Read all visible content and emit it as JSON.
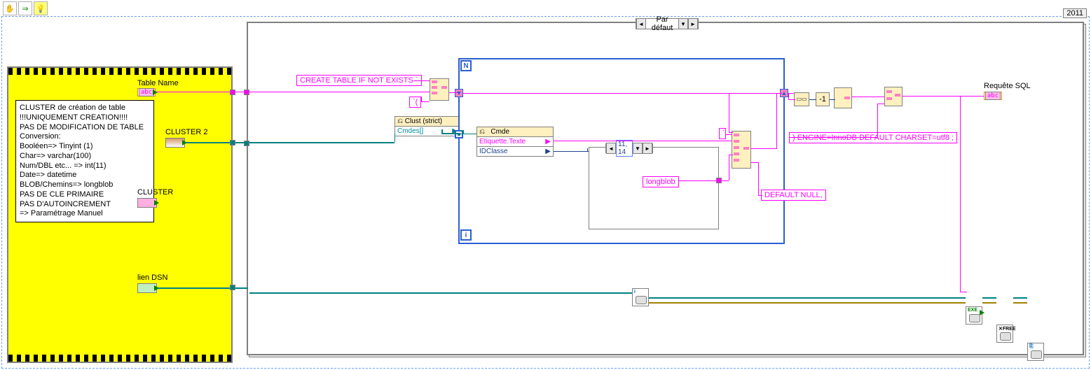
{
  "toolbar": {
    "hand": "✋",
    "arrow": "⇒",
    "bulb": "💡"
  },
  "year": "2011",
  "case": {
    "selector": "Par défaut"
  },
  "inputs": {
    "table_name": "Table Name",
    "cluster2": "CLUSTER 2",
    "cluster": "CLUSTER",
    "dsn": "lien DSN"
  },
  "comment": {
    "l1": "CLUSTER de création de table",
    "l2": "",
    "l3": "!!!UNIQUEMENT CREATION!!!!",
    "l4": "PAS DE MODIFICATION DE TABLE",
    "l5": "",
    "l6": "Conversion:",
    "l7": "Booléen=> Tinyint (1)",
    "l8": "Char=> varchar(100)",
    "l9": "Num/DBL etc... => int(11)",
    "l10": "Date=> datetime",
    "l11": "BLOB/Chemins=> longblob",
    "l12": "",
    "l13": "PAS DE CLE PRIMAIRE",
    "l14": "PAS D'AUTOINCREMENT",
    "l15": "",
    "l16": "=> Paramétrage Manuel"
  },
  "constants": {
    "create": "CREATE TABLE IF NOT EXISTS `",
    "paren": "`(",
    "engine": ") ENGINE=InnoDB  DEFAULT CHARSET=utf8 ;",
    "longblob": "longblob",
    "default_null": "DEFAULT NULL,"
  },
  "nodes": {
    "clust": "Clust (strict)",
    "cmdes": "Cmdes[]",
    "cmde": "Cmde",
    "etiquette": "Etiquette.Texte",
    "idclasse": "IDClasse"
  },
  "enum": "11, 14",
  "loop": {
    "n": "N",
    "i": "i"
  },
  "output": {
    "sql": "Requête SQL"
  },
  "abc": "abc",
  "sym": {
    "left": "◄",
    "right": "►",
    "down": "▼",
    "play": "▶",
    "dots": "⋮"
  },
  "db": {
    "i": "i",
    "exe": "EXE",
    "free": "✕FREE",
    "close": "⎘"
  }
}
